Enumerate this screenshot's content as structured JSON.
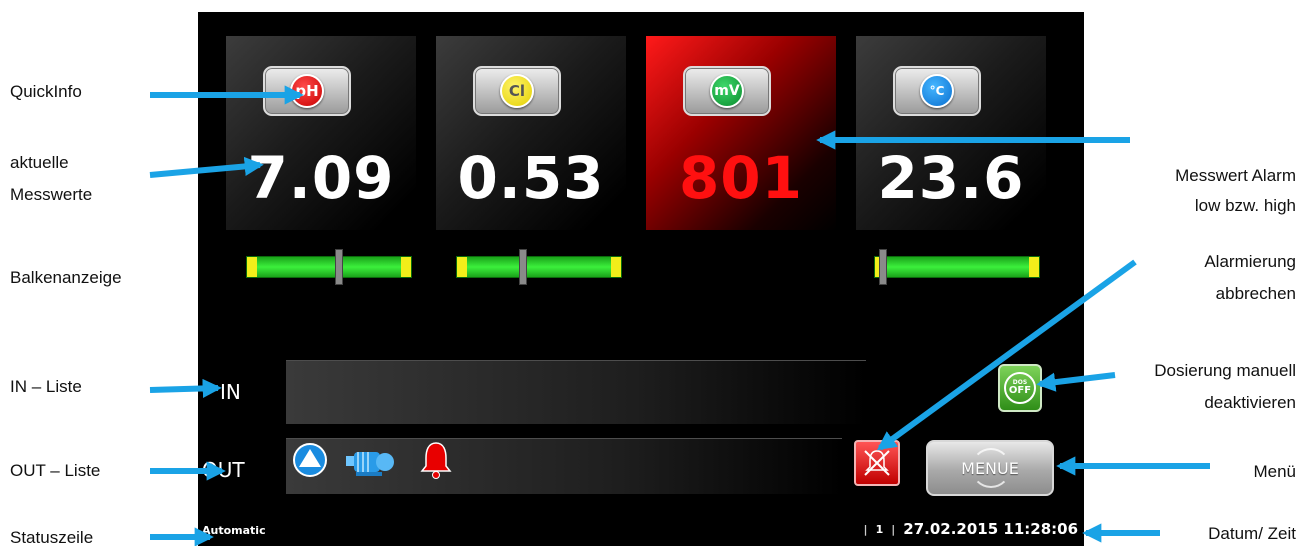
{
  "annotations": {
    "quickinfo": "QuickInfo",
    "messwerte_1": "aktuelle",
    "messwerte_2": "Messwerte",
    "balken": "Balkenanzeige",
    "in_liste": "IN – Liste",
    "out_liste": "OUT – Liste",
    "statuszeile": "Statuszeile",
    "alarm_1": "Messwert Alarm",
    "alarm_2": "low bzw. high",
    "abbrechen_1": "Alarmierung",
    "abbrechen_2": "abbrechen",
    "dosierung_1": "Dosierung manuell",
    "dosierung_2": "deaktivieren",
    "menu": "Menü",
    "datum": "Datum/ Zeit"
  },
  "tiles": [
    {
      "badge": "pH",
      "value": "7.09",
      "alarm": false,
      "bar_level": 0.56
    },
    {
      "badge": "Cl",
      "value": "0.53",
      "alarm": false,
      "bar_level": 0.4
    },
    {
      "badge": "mV",
      "value": "801",
      "alarm": true,
      "bar_level": null
    },
    {
      "badge": "°C",
      "value": "23.6",
      "alarm": false,
      "bar_level": 0.05
    }
  ],
  "io": {
    "in_label": "IN",
    "out_label": "OUT"
  },
  "buttons": {
    "dos_small": "DOS",
    "dos_big": "OFF",
    "menu": "MENUE"
  },
  "status": {
    "mode": "Automatic",
    "sep1": "|",
    "page": "1",
    "sep2": "|",
    "datetime": "27.02.2015 11:28:06"
  },
  "colors": {
    "alarm": "#ff1010",
    "bar": "#3cf03c",
    "bar_end": "#f2ee1a",
    "arrow": "#1aa3e6"
  },
  "icons": [
    "level-triangle-icon",
    "pump-icon",
    "alarm-bell-icon",
    "alarm-cancel-icon",
    "thermometer-icon"
  ]
}
